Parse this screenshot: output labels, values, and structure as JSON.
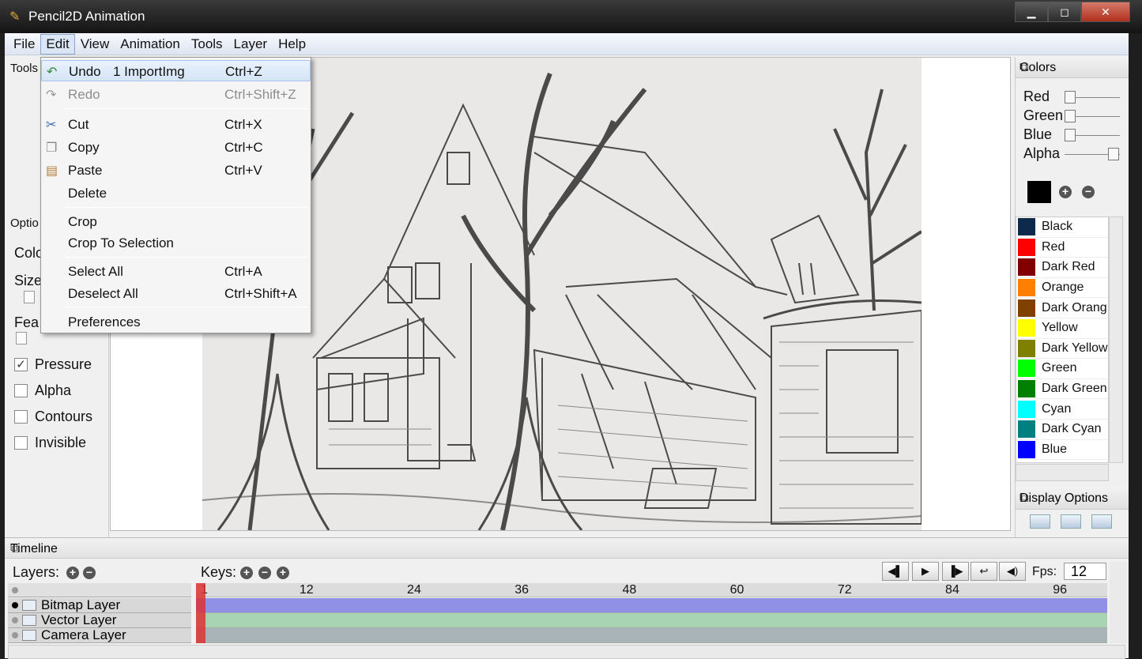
{
  "window": {
    "title": "Pencil2D Animation"
  },
  "menubar": [
    "File",
    "Edit",
    "View",
    "Animation",
    "Tools",
    "Layer",
    "Help"
  ],
  "edit_menu": {
    "undo": {
      "label": "Undo",
      "detail": "1 ImportImg",
      "shortcut": "Ctrl+Z"
    },
    "redo": {
      "label": "Redo",
      "shortcut": "Ctrl+Shift+Z"
    },
    "cut": {
      "label": "Cut",
      "shortcut": "Ctrl+X"
    },
    "copy": {
      "label": "Copy",
      "shortcut": "Ctrl+C"
    },
    "paste": {
      "label": "Paste",
      "shortcut": "Ctrl+V"
    },
    "delete": {
      "label": "Delete"
    },
    "crop": {
      "label": "Crop"
    },
    "crop_to_selection": {
      "label": "Crop To Selection"
    },
    "select_all": {
      "label": "Select All",
      "shortcut": "Ctrl+A"
    },
    "deselect_all": {
      "label": "Deselect All",
      "shortcut": "Ctrl+Shift+A"
    },
    "preferences": {
      "label": "Preferences"
    }
  },
  "tools_panel": {
    "title": "Tools"
  },
  "options_panel": {
    "title": "Optio",
    "color_label": "Colo",
    "size_label": "Size",
    "feather_label": "Fea",
    "checkboxes": [
      {
        "label": "Pressure",
        "checked": true
      },
      {
        "label": "Alpha",
        "checked": false
      },
      {
        "label": "Contours",
        "checked": false
      },
      {
        "label": "Invisible",
        "checked": false
      }
    ]
  },
  "colors_panel": {
    "title": "Colors",
    "sliders": [
      "Red",
      "Green",
      "Blue",
      "Alpha"
    ],
    "current_color": "#000000",
    "palette": [
      {
        "name": "Black",
        "color": "#0d2a4a"
      },
      {
        "name": "Red",
        "color": "#ff0000"
      },
      {
        "name": "Dark Red",
        "color": "#800000"
      },
      {
        "name": "Orange",
        "color": "#ff8000"
      },
      {
        "name": "Dark Orang",
        "color": "#804000"
      },
      {
        "name": "Yellow",
        "color": "#ffff00"
      },
      {
        "name": "Dark Yellow",
        "color": "#808000"
      },
      {
        "name": "Green",
        "color": "#00ff00"
      },
      {
        "name": "Dark Green",
        "color": "#008000"
      },
      {
        "name": "Cyan",
        "color": "#00ffff"
      },
      {
        "name": "Dark Cyan",
        "color": "#008080"
      },
      {
        "name": "Blue",
        "color": "#0000ff"
      }
    ]
  },
  "display_options": {
    "title": "Display Options"
  },
  "timeline": {
    "title": "Timeline",
    "layers_label": "Layers:",
    "keys_label": "Keys:",
    "fps_label": "Fps:",
    "fps_value": "12",
    "frame_labels": [
      "1",
      "12",
      "24",
      "36",
      "48",
      "60",
      "72",
      "84",
      "96"
    ],
    "layers": [
      {
        "name": "Bitmap Layer",
        "color": "#9090e6",
        "visible": true
      },
      {
        "name": "Vector Layer",
        "color": "#a8d4b4",
        "visible": false
      },
      {
        "name": "Camera Layer",
        "color": "#a8b4b8",
        "visible": false
      }
    ]
  }
}
